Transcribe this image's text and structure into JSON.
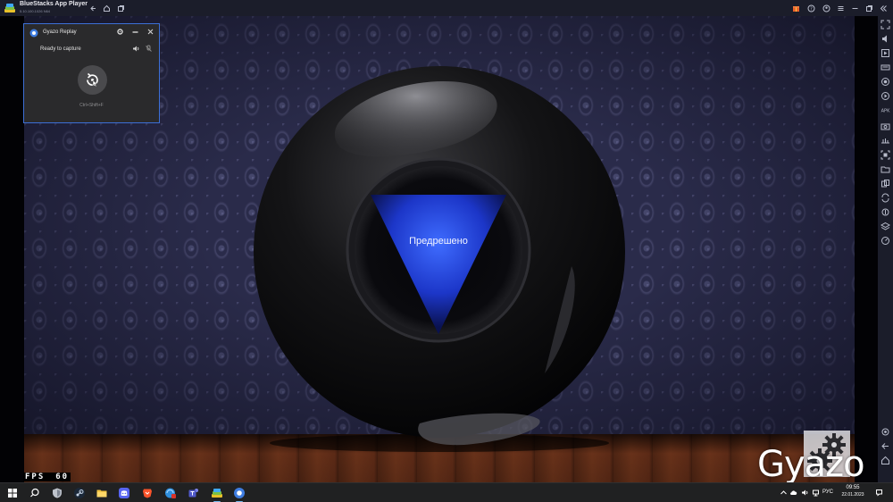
{
  "window": {
    "title": "BlueStacks App Player",
    "subtitle": "5.10.100.1026 N64"
  },
  "game": {
    "answer": "Предрешено",
    "fps_label": "FPS",
    "fps_value": "60"
  },
  "gyazo_panel": {
    "title": "Gyazo Replay",
    "status": "Ready to capture",
    "shortcut": "Ctrl+Shift+F"
  },
  "watermark": {
    "text": "Gyazo"
  },
  "taskbar": {
    "language": "РУС",
    "time": "09:55",
    "date": "22.01.2023"
  },
  "colors": {
    "titlebar": "#1b1d2a",
    "panel_border": "#3c6fd6",
    "answer_blue": "#2a4fe0",
    "taskbar": "#202122"
  }
}
